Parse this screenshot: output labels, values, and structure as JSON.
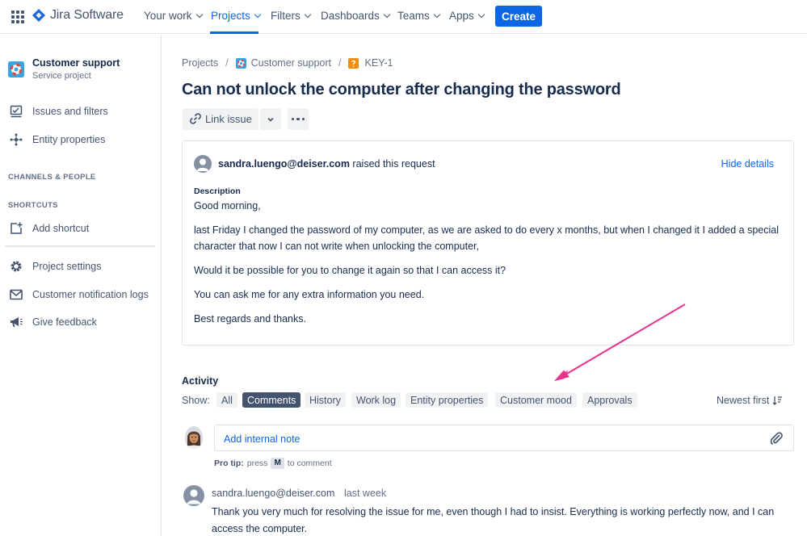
{
  "topnav": {
    "logo_text": "Jira Software",
    "items": [
      {
        "label": "Your work"
      },
      {
        "label": "Projects"
      },
      {
        "label": "Filters"
      },
      {
        "label": "Dashboards"
      },
      {
        "label": "Teams"
      },
      {
        "label": "Apps"
      }
    ],
    "active_item": "Projects",
    "create_label": "Create"
  },
  "sidebar": {
    "project_name": "Customer support",
    "project_type": "Service project",
    "items": [
      {
        "label": "Issues and filters",
        "icon": "issues-icon"
      },
      {
        "label": "Entity properties",
        "icon": "entity-properties-icon"
      }
    ],
    "heading_channels": "CHANNELS & PEOPLE",
    "heading_shortcuts": "SHORTCUTS",
    "add_shortcut": "Add shortcut",
    "bottom_items": [
      {
        "label": "Project settings",
        "icon": "gear-icon"
      },
      {
        "label": "Customer notification logs",
        "icon": "mail-icon"
      },
      {
        "label": "Give feedback",
        "icon": "megaphone-icon"
      }
    ]
  },
  "breadcrumb": {
    "projects": "Projects",
    "project": "Customer support",
    "issue_key": "KEY-1"
  },
  "issue": {
    "title": "Can not unlock the computer after changing the password",
    "link_issue_label": "Link issue"
  },
  "request": {
    "reporter": "sandra.luengo@deiser.com",
    "action": "raised this request",
    "hide_details": "Hide details",
    "description_label": "Description",
    "paragraphs": [
      "Good morning,",
      "last Friday I changed the password of my computer, as we are asked to do every x months, but when I changed it I added a special character that now I can not write when unlocking the computer,",
      "Would it be possible for you to change it again so that I can access it?",
      "You can ask me for any extra information you need.",
      "Best regards and thanks."
    ]
  },
  "activity": {
    "title": "Activity",
    "show_label": "Show:",
    "filters": [
      "All",
      "Comments",
      "History",
      "Work log",
      "Entity properties",
      "Customer mood",
      "Approvals"
    ],
    "selected_filter": "Comments",
    "sort_label": "Newest first",
    "note_label": "Add internal note",
    "protip_prefix": "Pro tip:",
    "protip_press": "press",
    "protip_key": "M",
    "protip_suffix": "to comment"
  },
  "comment": {
    "author": "sandra.luengo@deiser.com",
    "time": "last week",
    "body": "Thank you very much for resolving the issue for me, even though I had to insist. Everything is working perfectly now, and I can access the computer."
  },
  "colors": {
    "brand_blue": "#0c66e4",
    "annotation_arrow": "#e8338c",
    "selected_filter_bg": "#44546f"
  }
}
